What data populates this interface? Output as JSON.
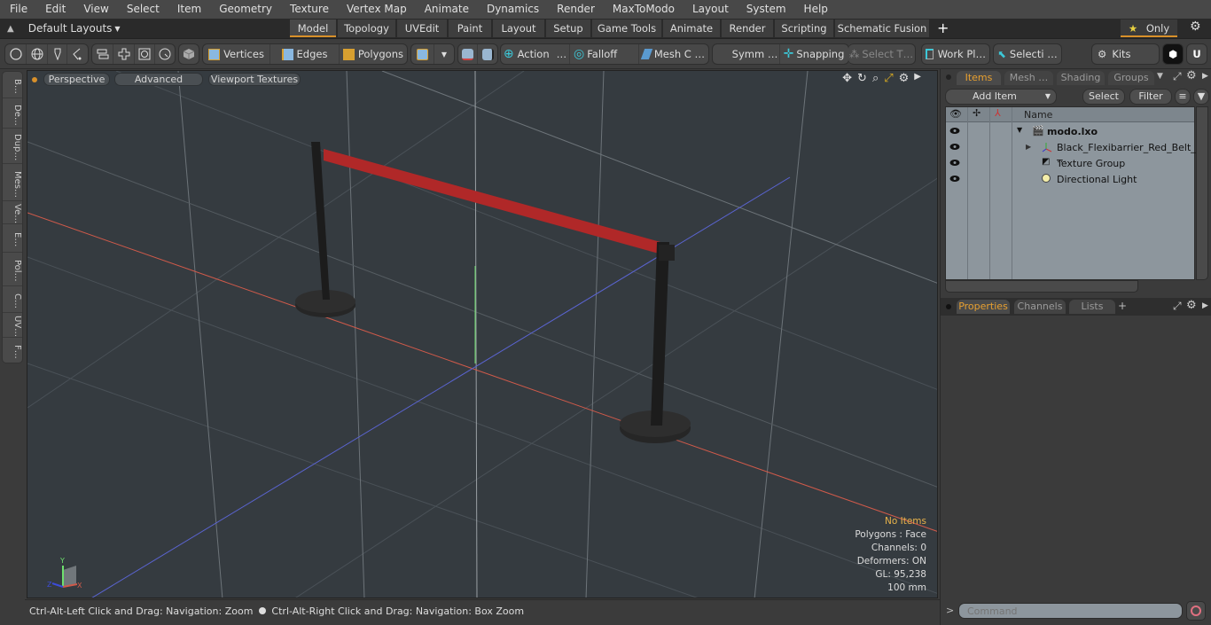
{
  "menu": [
    "File",
    "Edit",
    "View",
    "Select",
    "Item",
    "Geometry",
    "Texture",
    "Vertex Map",
    "Animate",
    "Dynamics",
    "Render",
    "MaxToModo",
    "Layout",
    "System",
    "Help"
  ],
  "layouts": {
    "label": "Default Layouts"
  },
  "layout_tabs": [
    "Model",
    "Topology",
    "UVEdit",
    "Paint",
    "Layout",
    "Setup",
    "Game Tools",
    "Animate",
    "Render",
    "Scripting",
    "Schematic Fusion"
  ],
  "active_layout_tab": "Model",
  "only_button": {
    "star": "★",
    "label": "Only"
  },
  "toolbar": {
    "vertices": "Vertices",
    "edges": "Edges",
    "polygons": "Polygons",
    "action": "Action",
    "action_more": "…",
    "falloff": "Falloff",
    "mesh_c": "Mesh C …",
    "symm": "Symm …",
    "snapping": "Snapping",
    "select_t": "Select T…",
    "work_pl": "Work Pl…",
    "selecti": "Selecti …",
    "kits": "Kits"
  },
  "left_tabs": [
    "B…",
    "De…",
    "Dup…",
    "Mes…",
    "Ve…",
    "E…",
    "Pol…",
    "C…",
    "UV…",
    "F…"
  ],
  "viewport": {
    "view_mode": "Perspective",
    "shading": "Advanced",
    "textures": "Viewport Textures",
    "stats": {
      "selection": "No Items",
      "polygons": "Polygons : Face",
      "channels": "Channels: 0",
      "deformers": "Deformers: ON",
      "gl": "GL: 95,238",
      "unit": "100 mm"
    },
    "axes": {
      "x": "X",
      "y": "Y",
      "z": "Z"
    },
    "colors": {
      "belt": "#b02828",
      "x_axis": "#d05a4a",
      "z_axis": "#5a64d0",
      "y_axis": "#6ee06e"
    }
  },
  "status_bar": {
    "left": "Ctrl-Alt-Left Click and Drag: Navigation: Zoom",
    "right": "Ctrl-Alt-Right Click and Drag: Navigation: Box Zoom"
  },
  "items_panel": {
    "tabs": [
      "Items",
      "Mesh …",
      "Shading",
      "Groups"
    ],
    "active_tab": "Items",
    "add_item": "Add Item",
    "select": "Select",
    "filter": "Filter",
    "name_header": "Name",
    "rows": [
      {
        "label": "modo.lxo",
        "bold": true
      },
      {
        "label": "Black_Flexibarrier_Red_Belt_ …"
      },
      {
        "label": "Texture Group"
      },
      {
        "label": "Directional Light"
      }
    ]
  },
  "properties_panel": {
    "tabs": [
      "Properties",
      "Channels",
      "Lists"
    ],
    "active_tab": "Properties",
    "add": "+"
  },
  "command": {
    "prompt": ">",
    "placeholder": "Command"
  },
  "accent_color": "#d8902a"
}
